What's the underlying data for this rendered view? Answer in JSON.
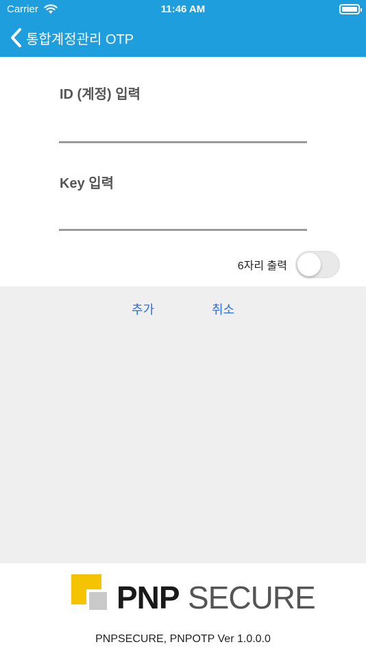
{
  "status_bar": {
    "carrier": "Carrier",
    "time": "11:46 AM"
  },
  "nav": {
    "title": "통합계정관리 OTP",
    "back_icon": "chevron-left-icon",
    "bar_color": "#1f9ede"
  },
  "form": {
    "id_label": "ID (계정) 입력",
    "id_value": "",
    "key_label": "Key 입력",
    "key_value": "",
    "six_digit_label": "6자리 출력",
    "six_digit_enabled": false
  },
  "actions": {
    "add_label": "추가",
    "cancel_label": "취소",
    "link_color": "#2a6fe0"
  },
  "footer": {
    "logo_pnp": "PNP",
    "logo_secure": "SECURE",
    "version_text": "PNPSECURE, PNPOTP Ver 1.0.0.0",
    "logo_accent": "#f5c400"
  }
}
